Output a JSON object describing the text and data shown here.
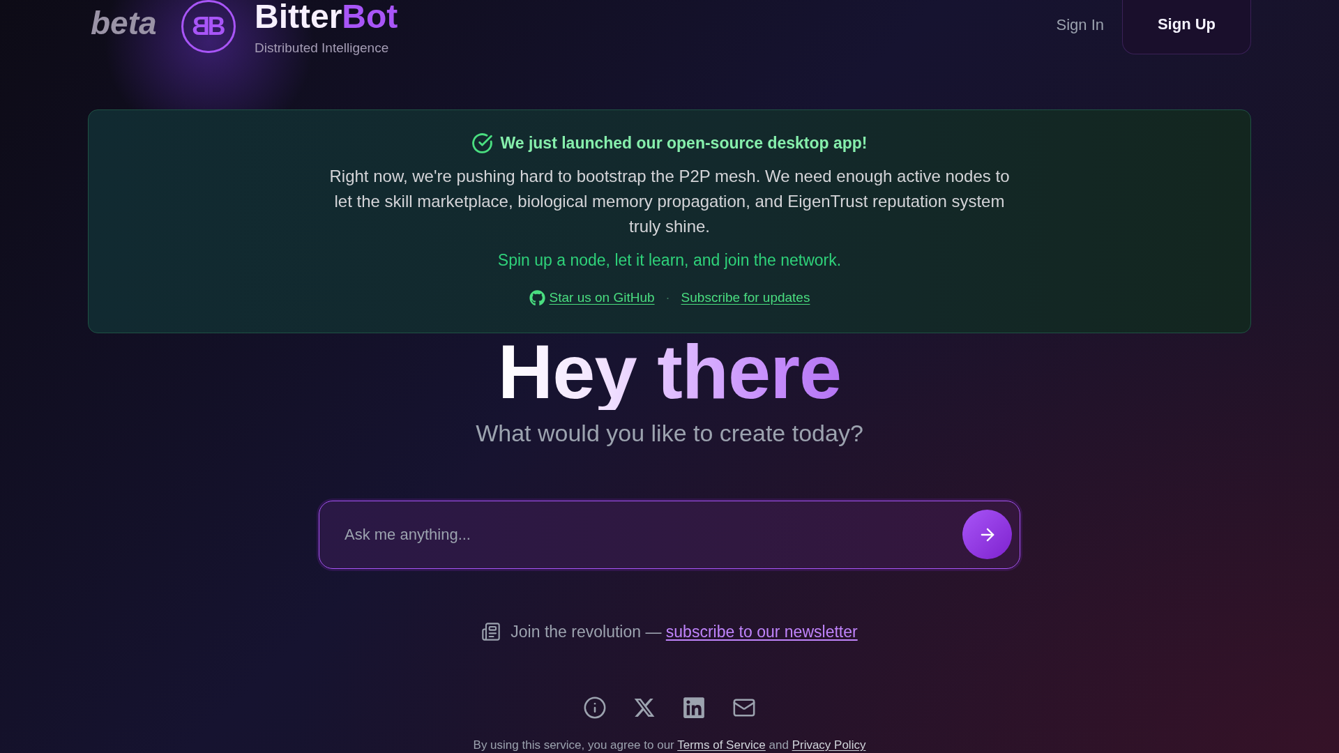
{
  "header": {
    "badge": "beta",
    "logo_monogram": "BB",
    "brand": {
      "part_1": "Bitter",
      "part_2": "Bot"
    },
    "tagline": "Distributed Intelligence",
    "nav": [
      {
        "kind": "link",
        "label": "Sign In"
      },
      {
        "kind": "button",
        "label": "Sign Up"
      }
    ]
  },
  "announcement": {
    "title": "We just launched our open-source desktop app!",
    "body": "Right now, we're pushing hard to bootstrap the P2P mesh. We need enough active nodes to let the skill marketplace, biological memory propagation, and EigenTrust reputation system truly shine.",
    "call_to_action": "Spin up a node, let it learn, and join the network.",
    "links": [
      {
        "kind": "github",
        "label": "Star us on GitHub"
      },
      {
        "kind": "plain",
        "label": "Subscribe for updates"
      }
    ],
    "separator": "·"
  },
  "hero": {
    "title": "Hey there",
    "subtitle": "What would you like to create today?"
  },
  "prompt": {
    "placeholder": "Ask me anything..."
  },
  "newsletter": {
    "text": "Join the revolution —",
    "link": "subscribe to our newsletter"
  },
  "footer": {
    "legal": [
      {
        "kind": "text",
        "text": "By using this service, you agree to our"
      },
      {
        "kind": "link",
        "text": "Terms of Service"
      },
      {
        "kind": "text",
        "text": "and"
      },
      {
        "kind": "link",
        "text": "Privacy Policy"
      }
    ]
  }
}
